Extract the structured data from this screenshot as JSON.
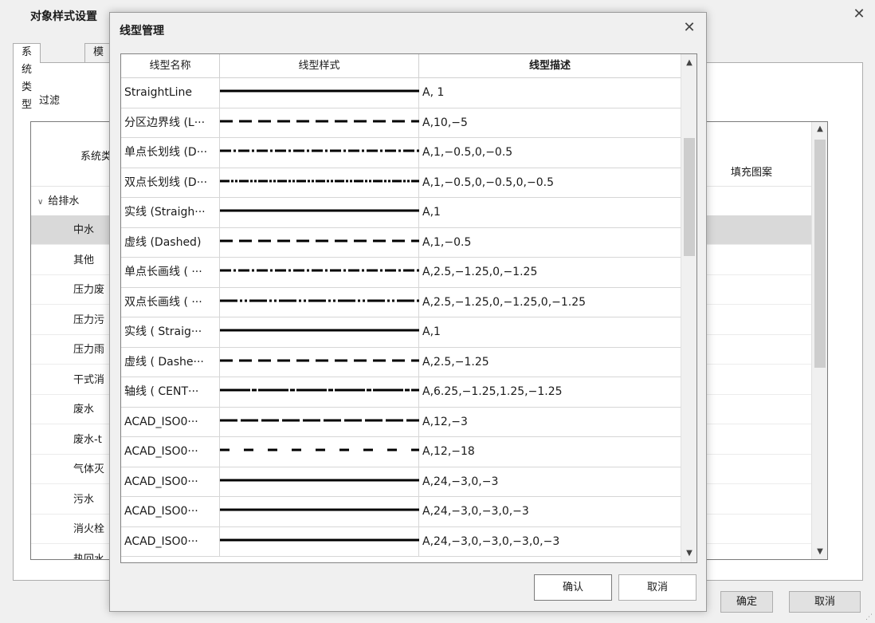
{
  "outer": {
    "title": "对象样式设置",
    "tabs": [
      {
        "label": "系统类型",
        "active": true
      },
      {
        "label": "模型",
        "active": false
      }
    ],
    "filter_label": "过滤",
    "columns": {
      "name": "系统类型",
      "fill": "填充图案"
    },
    "group": "给排水",
    "items": [
      "中水",
      "其他",
      "压力废",
      "压力污",
      "压力雨",
      "干式消",
      "废水",
      "废水-t",
      "气体灭",
      "污水",
      "消火栓",
      "热回水"
    ],
    "selected_index": 0,
    "ok_label": "确定",
    "cancel_label": "取消"
  },
  "dialog": {
    "title": "线型管理",
    "columns": {
      "name": "线型名称",
      "style": "线型样式",
      "desc": "线型描述"
    },
    "ok_label": "确认",
    "cancel_label": "取消",
    "rows": [
      {
        "name": "StraightLine",
        "desc": "A, 1",
        "pattern": "solid"
      },
      {
        "name": "分区边界线 (L···",
        "desc": "A,10,−5",
        "pattern": "dashed-long"
      },
      {
        "name": "单点长划线 (D···",
        "desc": "A,1,−0.5,0,−0.5",
        "pattern": "dashdot"
      },
      {
        "name": "双点长划线 (D···",
        "desc": "A,1,−0.5,0,−0.5,0,−0.5",
        "pattern": "dashdotdot"
      },
      {
        "name": "实线 (Straigh···",
        "desc": "A,1",
        "pattern": "solid"
      },
      {
        "name": "虚线 (Dashed)",
        "desc": "A,1,−0.5",
        "pattern": "dashed-long"
      },
      {
        "name": "单点长画线 ( ···",
        "desc": "A,2.5,−1.25,0,−1.25",
        "pattern": "dashdot"
      },
      {
        "name": "双点长画线 ( ···",
        "desc": "A,2.5,−1.25,0,−1.25,0,−1.25",
        "pattern": "dashdotdot-long"
      },
      {
        "name": "实线 ( Straig···",
        "desc": "A,1",
        "pattern": "solid"
      },
      {
        "name": "虚线 ( Dashe···",
        "desc": "A,2.5,−1.25",
        "pattern": "dashed-long"
      },
      {
        "name": "轴线 ( CENT···",
        "desc": "A,6.25,−1.25,1.25,−1.25",
        "pattern": "center"
      },
      {
        "name": "ACAD_ISO0···",
        "desc": "A,12,−3",
        "pattern": "dashed-xlong"
      },
      {
        "name": "ACAD_ISO0···",
        "desc": "A,12,−18",
        "pattern": "dashed-sparse"
      },
      {
        "name": "ACAD_ISO0···",
        "desc": "A,24,−3,0,−3",
        "pattern": "solid"
      },
      {
        "name": "ACAD_ISO0···",
        "desc": "A,24,−3,0,−3,0,−3",
        "pattern": "solid"
      },
      {
        "name": "ACAD_ISO0···",
        "desc": "A,24,−3,0,−3,0,−3,0,−3",
        "pattern": "solid"
      }
    ]
  },
  "icons": {
    "close": "close-icon",
    "scroll_up": "scroll-up-icon",
    "scroll_down": "scroll-down-icon",
    "chevron": "chevron-down-icon"
  }
}
